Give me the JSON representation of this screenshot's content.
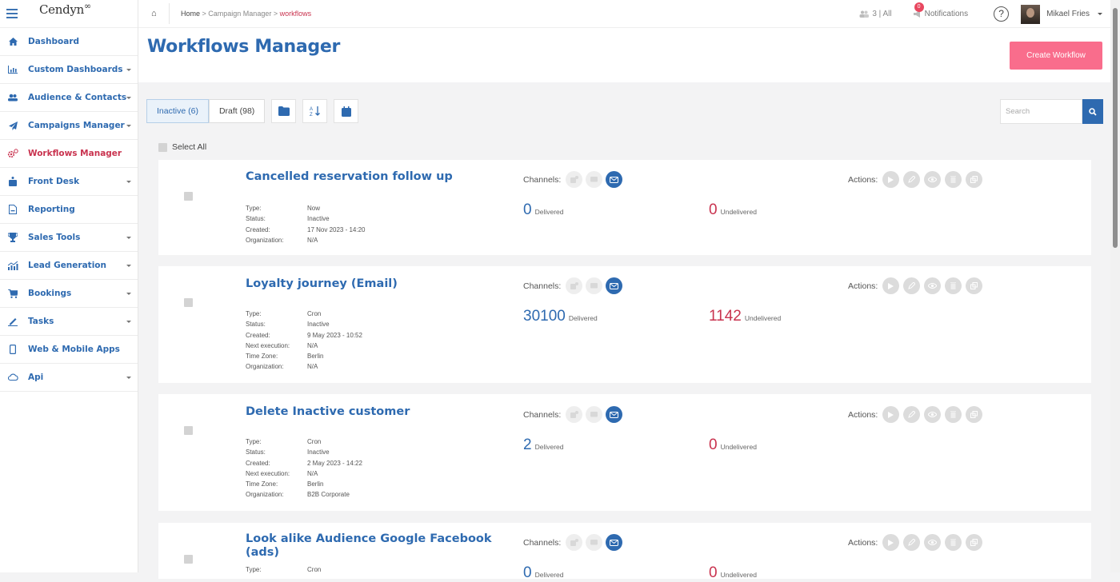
{
  "app": {
    "logo": "Cendyn",
    "logo_mark": "∞"
  },
  "sidebar": {
    "items": [
      {
        "label": "Dashboard",
        "icon": "home-icon",
        "expandable": false,
        "active": false
      },
      {
        "label": "Custom Dashboards",
        "icon": "bar-chart-icon",
        "expandable": true,
        "active": false
      },
      {
        "label": "Audience & Contacts",
        "icon": "users-icon",
        "expandable": true,
        "active": false
      },
      {
        "label": "Campaigns Manager",
        "icon": "paper-plane-icon",
        "expandable": true,
        "active": false
      },
      {
        "label": "Workflows Manager",
        "icon": "gears-icon",
        "expandable": false,
        "active": true
      },
      {
        "label": "Front Desk",
        "icon": "concierge-icon",
        "expandable": true,
        "active": false
      },
      {
        "label": "Reporting",
        "icon": "document-icon",
        "expandable": false,
        "active": false
      },
      {
        "label": "Sales Tools",
        "icon": "trophy-icon",
        "expandable": true,
        "active": false
      },
      {
        "label": "Lead Generation",
        "icon": "growth-chart-icon",
        "expandable": true,
        "active": false
      },
      {
        "label": "Bookings",
        "icon": "cart-icon",
        "expandable": true,
        "active": false
      },
      {
        "label": "Tasks",
        "icon": "pen-icon",
        "expandable": true,
        "active": false
      },
      {
        "label": "Web & Mobile Apps",
        "icon": "mobile-icon",
        "expandable": false,
        "active": false
      },
      {
        "label": "Api",
        "icon": "cloud-icon",
        "expandable": true,
        "active": false
      }
    ]
  },
  "topbar": {
    "breadcrumb": [
      "Home",
      "Campaign Manager",
      "workflows"
    ],
    "separator": " > ",
    "audience": "3 | All",
    "notifications_label": "Notifications",
    "notifications_count": "0",
    "help": "?",
    "user_name": "Mikael Fries"
  },
  "header": {
    "title": "Workflows Manager",
    "create_button": "Create Workflow"
  },
  "toolbar": {
    "tabs": [
      {
        "label": "Inactive (6)",
        "active": true
      },
      {
        "label": "Draft (98)",
        "active": false
      }
    ],
    "tools": [
      "folder-icon",
      "sort-alpha-icon",
      "calendar-icon"
    ],
    "search_placeholder": "Search",
    "select_all": "Select All"
  },
  "labels": {
    "channels": "Channels:",
    "actions": "Actions:",
    "delivered": "Delivered",
    "undelivered": "Undelivered"
  },
  "workflows": [
    {
      "title": "Cancelled reservation follow up",
      "meta": [
        [
          "Type:",
          "Now"
        ],
        [
          "Status:",
          "Inactive"
        ],
        [
          "Created:",
          "17 Nov 2023 - 14:20"
        ],
        [
          "Organization:",
          "N/A"
        ]
      ],
      "delivered": "0",
      "undelivered": "0"
    },
    {
      "title": "Loyalty journey (Email)",
      "meta": [
        [
          "Type:",
          "Cron"
        ],
        [
          "Status:",
          "Inactive"
        ],
        [
          "Created:",
          "9 May 2023 - 10:52"
        ],
        [
          "Next execution:",
          "N/A"
        ],
        [
          "Time Zone:",
          "Berlin"
        ],
        [
          "Organization:",
          "N/A"
        ]
      ],
      "delivered": "30100",
      "undelivered": "1142"
    },
    {
      "title": "Delete Inactive customer",
      "meta": [
        [
          "Type:",
          "Cron"
        ],
        [
          "Status:",
          "Inactive"
        ],
        [
          "Created:",
          "2 May 2023 - 14:22"
        ],
        [
          "Next execution:",
          "N/A"
        ],
        [
          "Time Zone:",
          "Berlin"
        ],
        [
          "Organization:",
          "B2B Corporate"
        ]
      ],
      "delivered": "2",
      "undelivered": "0"
    },
    {
      "title": "Look alike Audience Google Facebook (ads)",
      "meta": [
        [
          "Type:",
          "Cron"
        ]
      ],
      "delivered": "0",
      "undelivered": "0"
    }
  ],
  "channels": [
    {
      "icon": "push-notification-icon",
      "enabled": false
    },
    {
      "icon": "sms-icon",
      "enabled": false
    },
    {
      "icon": "email-icon",
      "enabled": true
    }
  ],
  "actions": [
    "play-icon",
    "edit-icon",
    "view-icon",
    "delete-icon",
    "duplicate-icon"
  ],
  "colors": {
    "primary": "#2e6ab0",
    "accent": "#c9334f",
    "create": "#f96d8c"
  }
}
